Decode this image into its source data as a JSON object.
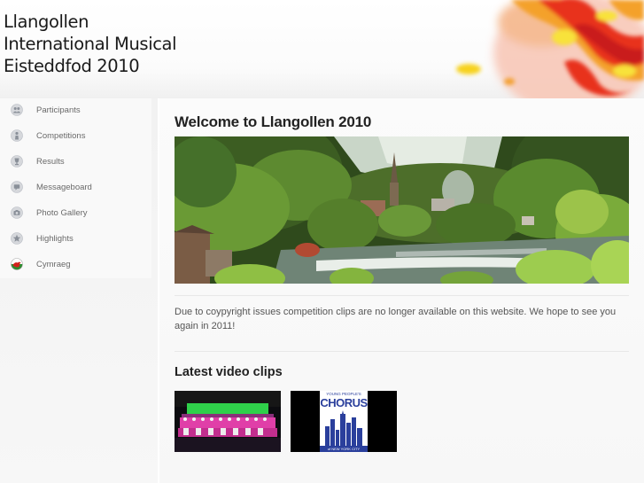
{
  "site": {
    "title": "Llangollen\nInternational Musical\nEisteddfod 2010"
  },
  "sidebar": {
    "items": [
      {
        "label": "Participants",
        "icon": "people-icon"
      },
      {
        "label": "Competitions",
        "icon": "person-icon"
      },
      {
        "label": "Results",
        "icon": "trophy-icon"
      },
      {
        "label": "Messageboard",
        "icon": "message-icon"
      },
      {
        "label": "Photo Gallery",
        "icon": "camera-icon"
      },
      {
        "label": "Highlights",
        "icon": "star-icon"
      },
      {
        "label": "Cymraeg",
        "icon": "welsh-dragon-icon"
      }
    ]
  },
  "main": {
    "title": "Welcome to Llangollen 2010",
    "notice": "Due to coypyright issues competition clips are no longer available on this website. We hope to see you again in 2011!",
    "clips_title": "Latest video clips",
    "clips": [
      {
        "name": "choir-stage-clip"
      },
      {
        "name": "young-peoples-chorus-clip",
        "logo_top": "YOUNG PEOPLE'S",
        "logo_main": "CHORUS",
        "logo_bottom": "of NEW YORK CITY"
      }
    ]
  },
  "colors": {
    "accent_red": "#e0301e",
    "accent_orange": "#f7a21b",
    "accent_yellow": "#f8e23a",
    "chorus_blue": "#2a3f9c"
  }
}
